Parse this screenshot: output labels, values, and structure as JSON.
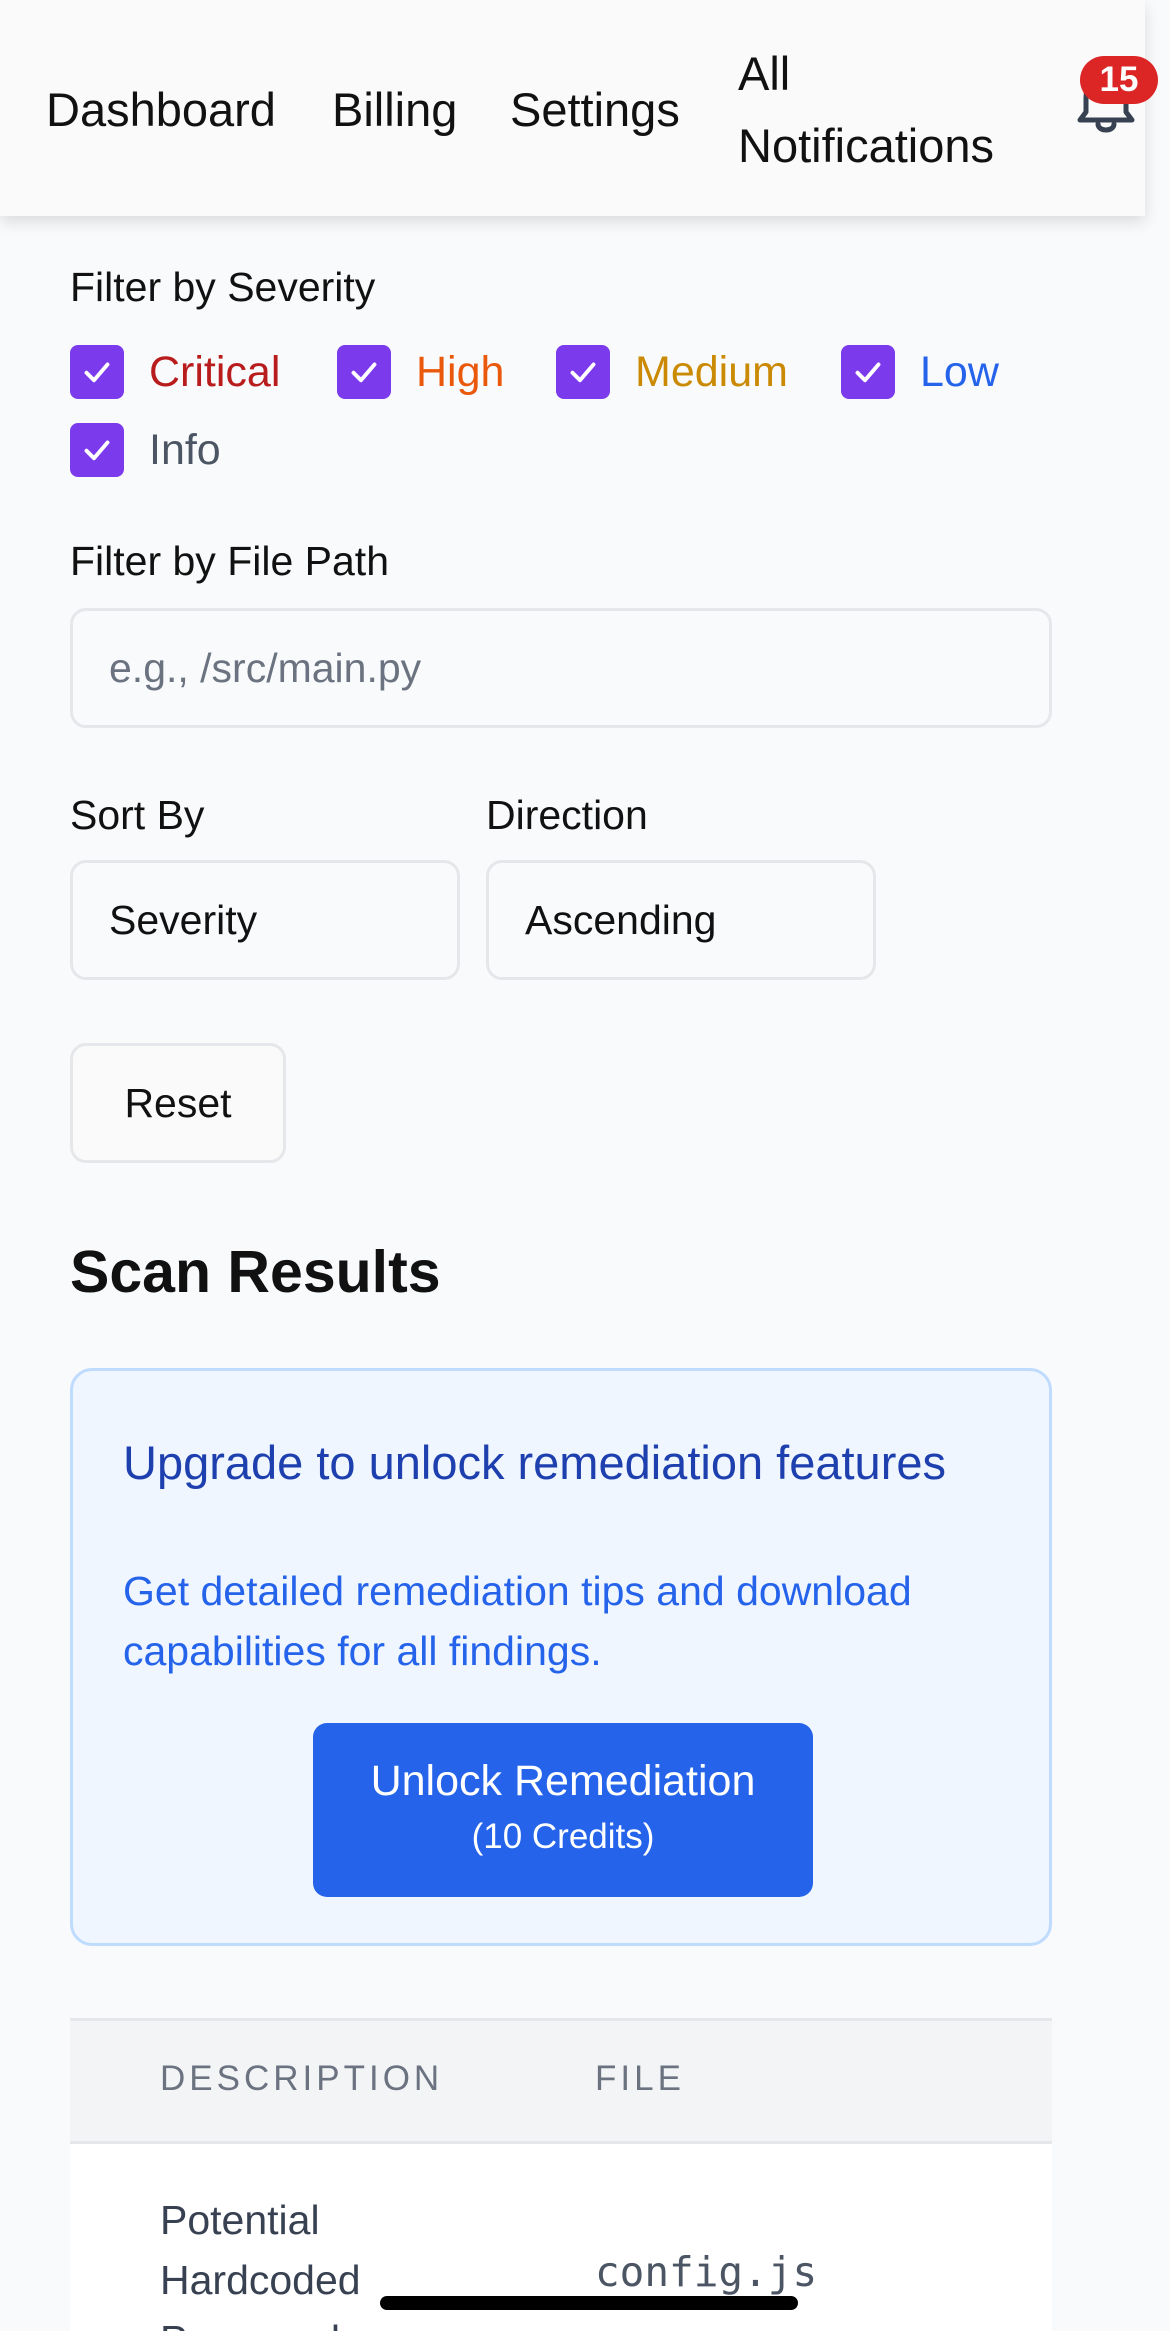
{
  "nav": {
    "dashboard": "Dashboard",
    "billing": "Billing",
    "settings": "Settings",
    "all_notifications_line1": "All",
    "all_notifications_line2": "Notifications",
    "notification_count": "15",
    "bell_icon": "bell-icon"
  },
  "filters": {
    "severity_label": "Filter by Severity",
    "severities": [
      {
        "label": "Critical",
        "checked": true,
        "color": "#b91c1c"
      },
      {
        "label": "High",
        "checked": true,
        "color": "#ea580c"
      },
      {
        "label": "Medium",
        "checked": true,
        "color": "#ca8a04"
      },
      {
        "label": "Low",
        "checked": true,
        "color": "#2563eb"
      },
      {
        "label": "Info",
        "checked": true,
        "color": "#4b5563"
      }
    ],
    "file_path_label": "Filter by File Path",
    "file_path_placeholder": "e.g., /src/main.py",
    "file_path_value": "",
    "sort_by_label": "Sort By",
    "sort_by_value": "Severity",
    "direction_label": "Direction",
    "direction_value": "Ascending",
    "reset_label": "Reset"
  },
  "results": {
    "heading": "Scan Results",
    "upgrade": {
      "title": "Upgrade to unlock remediation features",
      "description": "Get detailed remediation tips and download capabilities for all findings.",
      "button_line1": "Unlock Remediation",
      "button_line2": "(10 Credits)"
    },
    "table": {
      "columns": [
        "DESCRIPTION",
        "FILE"
      ],
      "rows": [
        {
          "description": "Potential Hardcoded Password",
          "file": "config.js"
        }
      ]
    }
  },
  "colors": {
    "accent": "#7c3aed",
    "primary": "#2563eb",
    "badge": "#dc2626"
  }
}
